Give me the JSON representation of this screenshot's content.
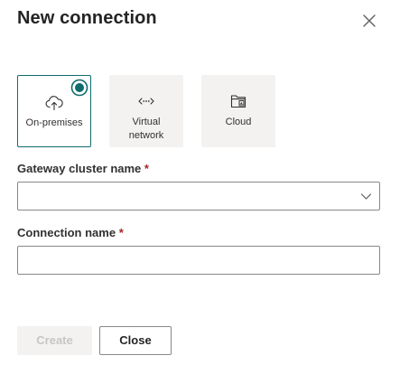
{
  "dialog": {
    "title": "New connection",
    "close_icon": "close-icon"
  },
  "connection_types": [
    {
      "label": "On-premises",
      "icon": "cloud-upload-icon",
      "selected": true
    },
    {
      "label": "Virtual\nnetwork",
      "icon": "virtual-network-icon",
      "selected": false
    },
    {
      "label": "Cloud",
      "icon": "cloud-app-icon",
      "selected": false
    }
  ],
  "gateway_cluster": {
    "label": "Gateway cluster name",
    "required_marker": "*",
    "value": ""
  },
  "connection_name": {
    "label": "Connection name",
    "required_marker": "*",
    "value": ""
  },
  "footer": {
    "create_label": "Create",
    "close_label": "Close"
  },
  "colors": {
    "accent": "#0f6c6d",
    "required": "#a4262c",
    "border": "#8a8886",
    "card_bg": "#f3f2f1"
  }
}
